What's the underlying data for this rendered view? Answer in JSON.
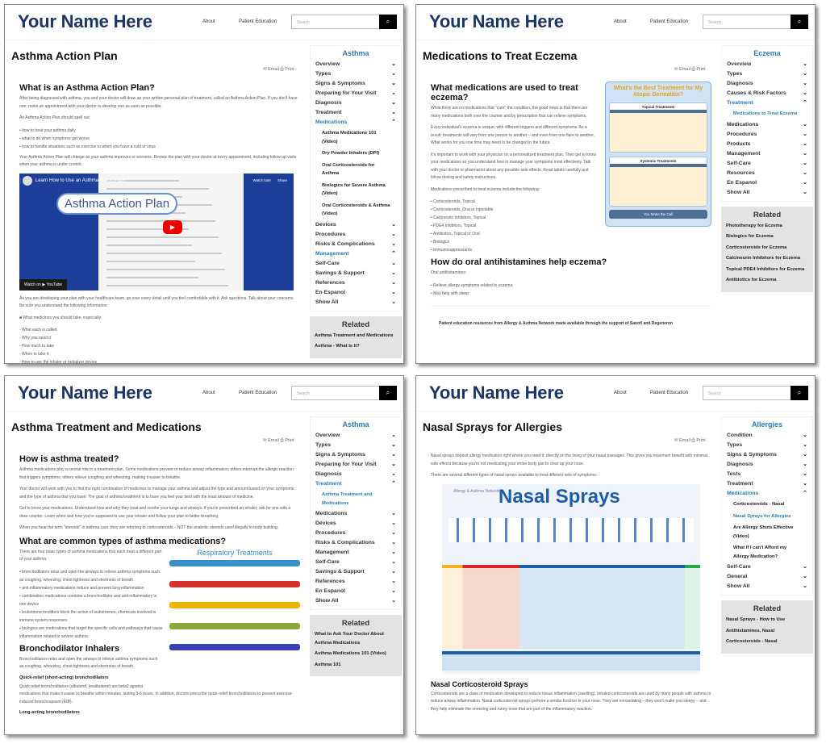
{
  "common": {
    "logo": "Your Name Here",
    "nav": [
      "About",
      "Patient Education"
    ],
    "search_placeholder": "Search",
    "search_icon": "magnifier-icon",
    "email": "✉ Email",
    "print": "⎙ Print",
    "related_title": "Related"
  },
  "panels": [
    {
      "title": "Asthma Action Plan",
      "side_title": "Asthma",
      "nav": [
        {
          "label": "Overview"
        },
        {
          "label": "Types"
        },
        {
          "label": "Signs & Symptoms"
        },
        {
          "label": "Preparing for Your Visit"
        },
        {
          "label": "Diagnosis"
        },
        {
          "label": "Treatment"
        },
        {
          "label": "Medications",
          "open": true,
          "sub": [
            {
              "label": "Asthma Medications 101 (Video)"
            },
            {
              "label": "Dry Powder Inhalers (DPI)"
            },
            {
              "label": "Oral Corticosteroids for Asthma"
            },
            {
              "label": "Biologics for Severe Asthma (Video)"
            },
            {
              "label": "Oral Corticosteroids & Asthma (Video)"
            }
          ]
        },
        {
          "label": "Devices"
        },
        {
          "label": "Procedures"
        },
        {
          "label": "Risks & Complications"
        },
        {
          "label": "Management",
          "open": true
        },
        {
          "label": "Self-Care"
        },
        {
          "label": "Savings & Support"
        },
        {
          "label": "References"
        },
        {
          "label": "En Espanol"
        },
        {
          "label": "Show All"
        }
      ],
      "related": [
        "Asthma Treatment and Medications",
        "Asthma - What Is It?"
      ],
      "blocks": [
        {
          "t": "h2",
          "text": "What is an Asthma Action Plan?"
        },
        {
          "t": "p",
          "text": "After being diagnosed with asthma, you and your doctor will draw up your written personal plan of treatment, called an Asthma Action Plan. If you don't have one, make an appointment with your doctor to develop one as soon as possible."
        },
        {
          "t": "p",
          "text": "An Asthma Action Plan should spell out:"
        },
        {
          "t": "ul",
          "items": [
            "how to treat your asthma daily",
            "what to do when symptoms get worse",
            "how to handle situations such as exercise or when you have a cold or virus"
          ]
        },
        {
          "t": "p",
          "text": "Your Asthma Action Plan will change as your asthma improves or worsens. Review the plan with your doctor at every appointment, including follow-up visits when your asthma is under control."
        },
        {
          "t": "video",
          "title": "Learn How to Use an Asthma Action Plan",
          "overlay": "Asthma Action Plan",
          "watch_later": "Watch later",
          "share": "Share",
          "watch_on": "Watch on ▶ YouTube"
        },
        {
          "t": "p",
          "text": "As you are developing your plan with your healthcare team, go over every detail until you feel comfortable with it. Ask questions. Talk about your concerns. Be sure you understand the following information:"
        },
        {
          "t": "p",
          "text": "■ What medicines you should take, especially:"
        },
        {
          "t": "dl",
          "items": [
            "- What each is called",
            "- Why you need it",
            "- How much to take",
            "- When to take it",
            "- How to use the inhaler or nebulizer device"
          ]
        }
      ]
    },
    {
      "title": "Medications to Treat Eczema",
      "side_title": "Eczema",
      "nav": [
        {
          "label": "Overview"
        },
        {
          "label": "Types"
        },
        {
          "label": "Diagnosis"
        },
        {
          "label": "Causes & Risk Factors"
        },
        {
          "label": "Treatment",
          "open": true,
          "sub": [
            {
              "label": "Medications to Treat Eczema",
              "current": true
            }
          ]
        },
        {
          "label": "Medications"
        },
        {
          "label": "Procedures"
        },
        {
          "label": "Products"
        },
        {
          "label": "Management"
        },
        {
          "label": "Self-Care"
        },
        {
          "label": "Resources"
        },
        {
          "label": "En Espanol"
        },
        {
          "label": "Show All"
        }
      ],
      "related": [
        "Phototherapy for Eczema",
        "Biologics for Eczema",
        "Corticosteroids for Eczema",
        "Calcineurin Inhibitors for Eczema",
        "Topical PDE4 Inhibitors for Eczema",
        "Antibiotics for Eczema"
      ],
      "blocks": [
        {
          "t": "eczimg",
          "title": "What's the Best Treatment for My Atopic Dermatitis?",
          "topical": "Topical Treatments",
          "systemic": "Systemic Treatments",
          "call": "You Make the Call"
        },
        {
          "t": "h2",
          "text": "What medications are used to treat eczema?"
        },
        {
          "t": "p",
          "text": "While there are no medications that \"cure\" the condition, the good news is that there are many medications both over the counter and by prescription that can relieve symptoms."
        },
        {
          "t": "p",
          "text": "Every individual's eczema is unique, with different triggers and different symptoms. As a result, treatments will vary from one person to another – and even from one flare to another. What works for you one time may need to be changed in the future."
        },
        {
          "t": "p",
          "text": "It's important to work with your physician on a personalized treatment plan. Then get to know your medications so you understand how to manage your symptoms most effectively. Talk with your doctor or pharmacist about any possible side effects. Read labels carefully and follow dosing and safety instructions."
        },
        {
          "t": "p",
          "text": "Medications prescribed to treat eczema include the following:"
        },
        {
          "t": "ul",
          "items": [
            "Corticosteroids, Topical",
            "Corticosteroids, Oral or Injectable",
            "Calcineurin Inhibitors, Topical",
            "PDE4 Inhibitors, Topical",
            "Antibiotics, Topical or Oral",
            "Biologics",
            "Immunosuppressants"
          ]
        },
        {
          "t": "h2",
          "text": "How do oral antihistamines help eczema?"
        },
        {
          "t": "p",
          "text": "Oral antihistamines:"
        },
        {
          "t": "ul",
          "items": [
            "Relieve allergy symptoms related to eczema",
            "May help with sleep"
          ]
        },
        {
          "t": "foot",
          "text": "Patient education resources from Allergy & Asthma Network made available through the support of Sanofi and Regeneron"
        }
      ]
    },
    {
      "title": "Asthma Treatment and Medications",
      "side_title": "Asthma",
      "nav": [
        {
          "label": "Overview"
        },
        {
          "label": "Types"
        },
        {
          "label": "Signs & Symptoms"
        },
        {
          "label": "Preparing for Your Visit"
        },
        {
          "label": "Diagnosis"
        },
        {
          "label": "Treatment",
          "open": true,
          "sub": [
            {
              "label": "Asthma Treatment and Medications",
              "current": true
            }
          ]
        },
        {
          "label": "Medications"
        },
        {
          "label": "Devices"
        },
        {
          "label": "Procedures"
        },
        {
          "label": "Risks & Complications"
        },
        {
          "label": "Management"
        },
        {
          "label": "Self-Care"
        },
        {
          "label": "Savings & Support"
        },
        {
          "label": "References"
        },
        {
          "label": "En Espanol"
        },
        {
          "label": "Show All"
        }
      ],
      "related": [
        "What to Ask Your Doctor About Asthma Medications",
        "Asthma Medications 101 (Video)",
        "Asthma 101"
      ],
      "blocks": [
        {
          "t": "h2",
          "text": "How is asthma treated?"
        },
        {
          "t": "p",
          "text": "Asthma medications play a central role in a treatment plan. Some medications prevent or reduce airway inflammation; others interrupt the allergic reaction that triggers symptoms; others relieve coughing and wheezing, making it easier to breathe."
        },
        {
          "t": "p",
          "text": "Your doctor will work with you to find the right combination of medicines to manage your asthma and adjust the type and amount based on your symptoms and the type of asthma that you have. The goal of asthma treatment is to have you feel your best with the least amount of medicine."
        },
        {
          "t": "p",
          "text": "Get to know your medications. Understand how and why they treat and soothe your lungs and airways. If you're prescribed an inhaler, ask for one with a dose counter. Learn when and how you're supposed to use your inhaler and follow your plan to better breathing."
        },
        {
          "t": "p",
          "text": "When you hear the term \"steroids\" in asthma care, they are referring to corticosteroids – NOT the anabolic steroids used illegally in body building."
        },
        {
          "t": "h2",
          "text": "What are common types of asthma medications?"
        },
        {
          "t": "respimg",
          "title": "Respiratory Treatments"
        },
        {
          "t": "p",
          "text": "There are four basic types of asthma medications that each treat a different part of your asthma:"
        },
        {
          "t": "ul",
          "items": [
            "bronchodilators relax and open the airways to relieve asthma symptoms such as coughing, wheezing, chest tightness and shortness of breath",
            "anti-inflammatory medications reduce and prevent lung inflammation",
            "combination medications combine a bronchodilator and anti-inflammatory in one device",
            "leukotriene modifiers block the action of leukotrienes, chemicals involved in immune system responses",
            "biologics are medications that target the specific cells and pathways that cause inflammation related to severe asthma."
          ]
        },
        {
          "t": "h2",
          "text": "Bronchodilator Inhalers"
        },
        {
          "t": "p",
          "text": "Bronchodilators relax and open the airways to relieve asthma symptoms such as coughing, wheezing, chest tightness and shortness of breath."
        },
        {
          "t": "h3",
          "text": "Quick-relief (short-acting) bronchodilators"
        },
        {
          "t": "p",
          "text": "Quick-relief bronchodilators (albuterol, levalbuterol) are beta2 agonist medications that make it easier to breathe within minutes, lasting 3-6 hours. In addition, doctors prescribe quick-relief bronchodilators to prevent exercise-induced bronchospasm (EIB)."
        },
        {
          "t": "h3",
          "text": "Long-acting bronchodilators"
        }
      ]
    },
    {
      "title": "Nasal Sprays for Allergies",
      "side_title": "Allergies",
      "nav": [
        {
          "label": "Condition"
        },
        {
          "label": "Types"
        },
        {
          "label": "Signs & Symptoms"
        },
        {
          "label": "Diagnosis"
        },
        {
          "label": "Tests"
        },
        {
          "label": "Treatment"
        },
        {
          "label": "Medications",
          "open": true,
          "sub": [
            {
              "label": "Corticosteroids - Nasal"
            },
            {
              "label": "Nasal Sprays for Allergies",
              "current": true
            },
            {
              "label": "Are Allergy Shots Effective (Video)"
            },
            {
              "label": "What If I can't Afford my Allergy Medication?"
            }
          ]
        },
        {
          "label": "Self-Care"
        },
        {
          "label": "General"
        },
        {
          "label": "Show All"
        }
      ],
      "related": [
        "Nasal Sprays - How to Use",
        "Antihistamines, Nasal",
        "Corticosteroids - Nasal"
      ],
      "blocks": [
        {
          "t": "p",
          "text": "Nasal sprays deposit allergy medication right where you need it: directly on the lining of your nasal passages. This gives you maximum benefit with minimal side effects because you're not medicating your entire body just to clear up your nose."
        },
        {
          "t": "p",
          "text": "There are several different types of nasal sprays available to treat different sets of symptoms:"
        },
        {
          "t": "nasalimg",
          "title": "Nasal Sprays",
          "brand": "Allergy & Asthma Network"
        },
        {
          "t": "h3big",
          "text": "Nasal Corticosteroid Sprays"
        },
        {
          "t": "p",
          "text": "Corticosteroids are a class of medication developed to reduce tissue inflammation (swelling). Inhaled corticosteroids are used by many people with asthma to reduce airway inflammation. Nasal corticosteroid sprays perform a similar function in your nose. They are nonsedating – they won't make you sleepy – and they help eliminate the sneezing and runny nose that are part of the inflammatory reaction."
        }
      ]
    }
  ]
}
